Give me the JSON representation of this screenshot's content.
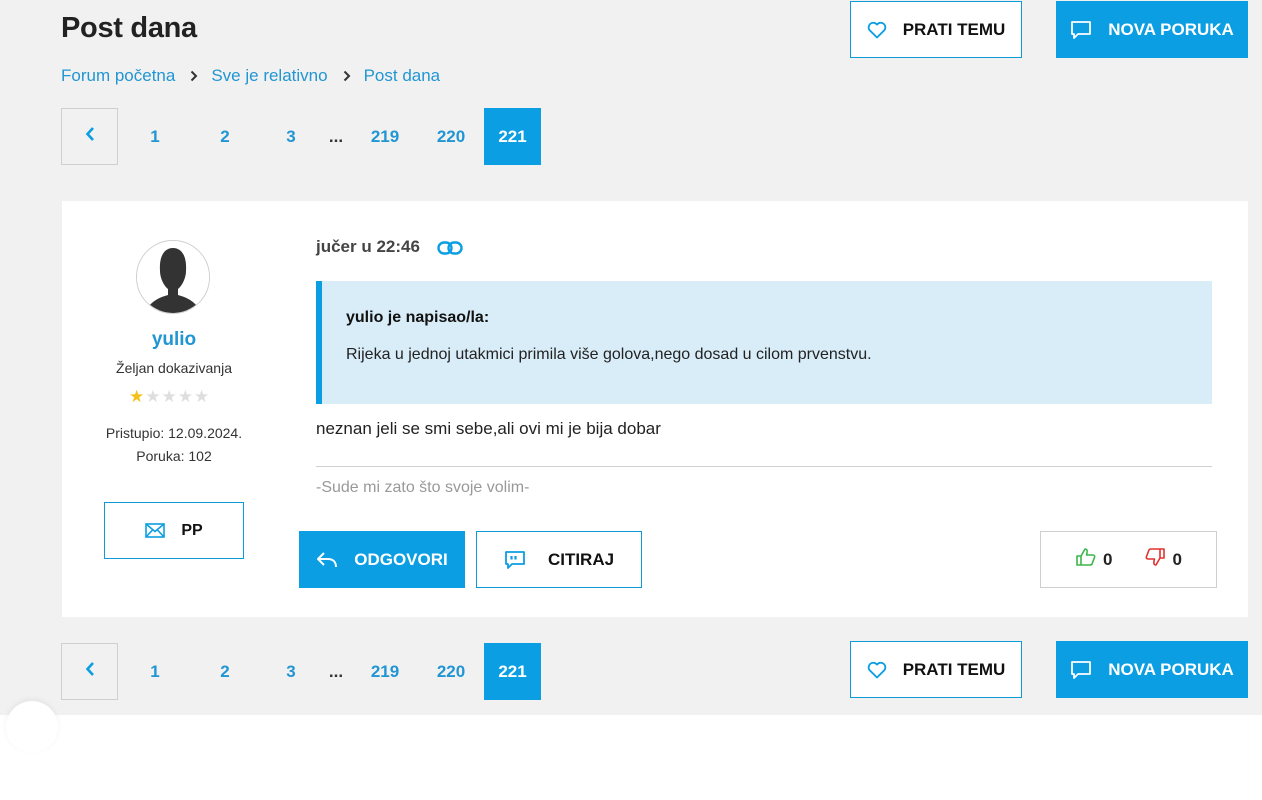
{
  "header": {
    "title": "Post dana",
    "follow_label": "PRATI TEMU",
    "new_post_label": "NOVA PORUKA"
  },
  "breadcrumb": [
    "Forum početna",
    "Sve je relativno",
    "Post dana"
  ],
  "pagination": {
    "pages": [
      "1",
      "2",
      "3"
    ],
    "ellipsis": "...",
    "last_pages": [
      "219",
      "220"
    ],
    "current": "221"
  },
  "post": {
    "author": {
      "username": "yulio",
      "rank": "Željan dokazivanja",
      "stars_filled": 1,
      "stars_total": 5,
      "joined": "Pristupio: 12.09.2024.",
      "posts": "Poruka: 102",
      "pm_label": "PP"
    },
    "time": "jučer u 22:46",
    "quote": {
      "author": "yulio je napisao/la:",
      "text": "Rijeka u jednoj utakmici primila više golova,nego dosad u cilom prvenstvu."
    },
    "content": "neznan jeli se smi sebe,ali ovi mi je bija dobar",
    "signature": "-Sude mi zato što svoje volim-",
    "reply_label": "ODGOVORI",
    "quote_label": "CITIRAJ",
    "likes": "0",
    "dislikes": "0"
  },
  "colors": {
    "accent": "#0b9ee3",
    "link": "#2196d3",
    "quote_bg": "#d9edf8",
    "like": "#3cb54a",
    "dislike": "#e0322f",
    "star": "#f4c118"
  },
  "icons": [
    "heart-icon",
    "chat-bubble-icon",
    "chevron-right-icon",
    "chevron-left-icon",
    "link-icon",
    "envelope-icon",
    "reply-arrow-icon",
    "quote-bubble-icon",
    "thumbs-up-icon",
    "thumbs-down-icon",
    "star-icon"
  ]
}
